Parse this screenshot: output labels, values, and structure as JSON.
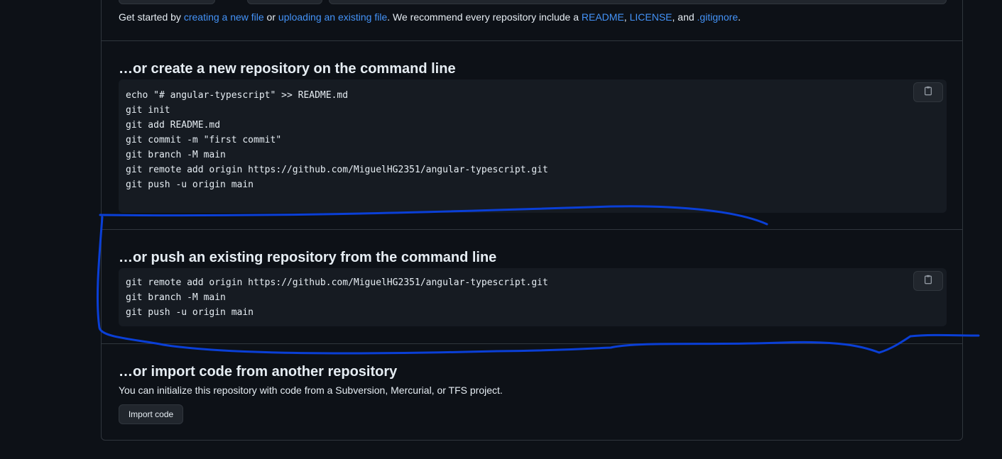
{
  "intro": {
    "prefix": "Get started by ",
    "link_create_file": "creating a new file",
    "or": " or ",
    "link_upload": "uploading an existing file",
    "middle": ". We recommend every repository include a ",
    "link_readme": "README",
    "comma": ", ",
    "link_license": "LICENSE",
    "and": ", and ",
    "link_gitignore": ".gitignore",
    "period": "."
  },
  "create_section": {
    "heading": "…or create a new repository on the command line",
    "lines": [
      "echo \"# angular-typescript\" >> README.md",
      "git init",
      "git add README.md",
      "git commit -m \"first commit\"",
      "git branch -M main",
      "git remote add origin https://github.com/MiguelHG2351/angular-typescript.git",
      "git push -u origin main"
    ]
  },
  "push_section": {
    "heading": "…or push an existing repository from the command line",
    "lines": [
      "git remote add origin https://github.com/MiguelHG2351/angular-typescript.git",
      "git branch -M main",
      "git push -u origin main"
    ]
  },
  "import_section": {
    "heading": "…or import code from another repository",
    "description": "You can initialize this repository with code from a Subversion, Mercurial, or TFS project.",
    "button_label": "Import code"
  },
  "icons": {
    "copy": "clipboard-icon"
  },
  "colors": {
    "background": "#0d1117",
    "code_bg": "#161b22",
    "border": "#30363d",
    "link": "#4493f8",
    "annotation": "#0a3fd6"
  }
}
